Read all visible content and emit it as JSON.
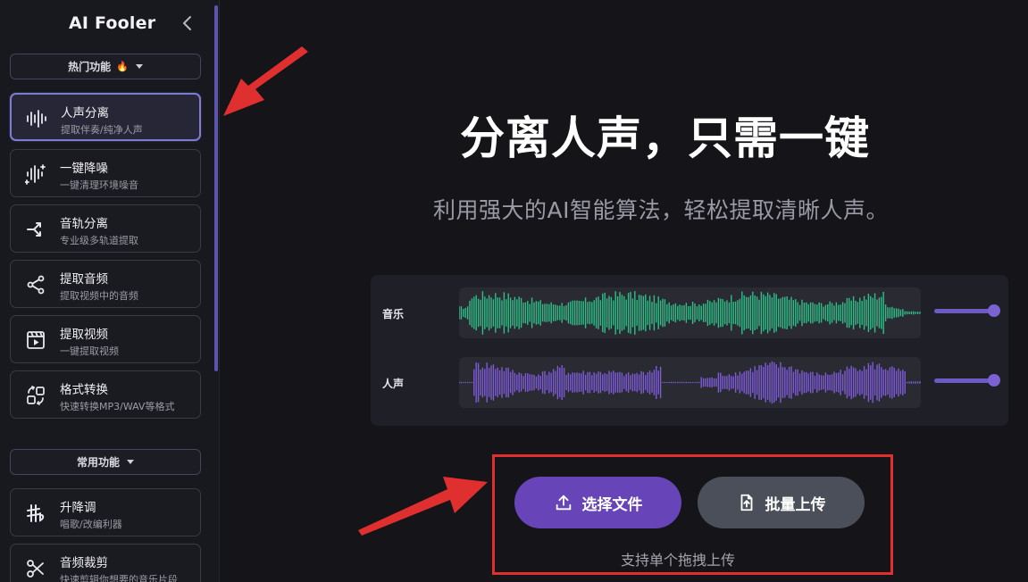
{
  "sidebar": {
    "title": "AI Fooler",
    "hot_section": {
      "label": "热门功能",
      "icon": "flame-icon"
    },
    "hot_items": [
      {
        "label": "人声分离",
        "desc": "提取伴奏/纯净人声",
        "icon": "waveform-icon",
        "active": true
      },
      {
        "label": "一键降噪",
        "desc": "一键清理环境噪音",
        "icon": "denoise-icon"
      },
      {
        "label": "音轨分离",
        "desc": "专业级多轨道提取",
        "icon": "split-icon"
      },
      {
        "label": "提取音频",
        "desc": "提取视频中的音频",
        "icon": "share-icon"
      },
      {
        "label": "提取视频",
        "desc": "一键提取视频",
        "icon": "video-icon"
      },
      {
        "label": "格式转换",
        "desc": "快速转换MP3/WAV等格式",
        "icon": "convert-icon"
      }
    ],
    "common_section": {
      "label": "常用功能"
    },
    "common_items": [
      {
        "label": "升降调",
        "desc": "唱歌/改编利器",
        "icon": "pitch-icon"
      },
      {
        "label": "音频裁剪",
        "desc": "快速剪辑你想要的音乐片段",
        "icon": "scissors-icon"
      }
    ]
  },
  "main": {
    "title": "分离人声，只需一键",
    "subtitle": "利用强大的AI智能算法，轻松提取清晰人声。",
    "tracks": [
      {
        "label": "音乐",
        "color": "#2fbf87",
        "volume": 1.0
      },
      {
        "label": "人声",
        "color": "#7d5cd6",
        "volume": 1.0
      }
    ],
    "buttons": {
      "select_label": "选择文件",
      "batch_label": "批量上传"
    },
    "hint": "支持单个拖拽上传"
  },
  "colors": {
    "accent": "#6744b8",
    "annotation_red": "#e02f2f"
  }
}
